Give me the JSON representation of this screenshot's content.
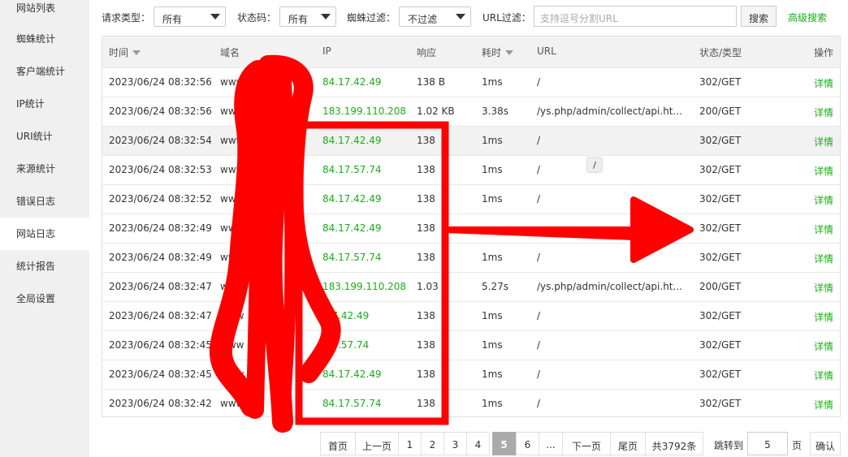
{
  "sidebar": {
    "items": [
      {
        "label": "网站列表"
      },
      {
        "label": "蜘蛛统计"
      },
      {
        "label": "客户端统计"
      },
      {
        "label": "IP统计"
      },
      {
        "label": "URI统计"
      },
      {
        "label": "来源统计"
      },
      {
        "label": "错误日志"
      },
      {
        "label": "网站日志"
      },
      {
        "label": "统计报告"
      },
      {
        "label": "全局设置"
      }
    ]
  },
  "filters": {
    "method_label": "请求类型：",
    "method_value": "所有",
    "status_label": "状态码：",
    "status_value": "所有",
    "spider_label": "蜘蛛过滤：",
    "spider_value": "不过滤",
    "url_label": "URL过滤：",
    "url_placeholder": "支持逗号分割URL",
    "search_label": "搜索",
    "advanced_label": "高级搜索"
  },
  "table": {
    "headers": {
      "time": "时间",
      "domain": "域名",
      "ip": "IP",
      "response": "响应",
      "duration": "耗时",
      "url": "URL",
      "status": "状态/类型",
      "action": "操作"
    },
    "rows": [
      {
        "time": "2023/06/24 08:32:56",
        "domain": "www",
        "ip": "84.17.42.49",
        "response": "138 B",
        "duration": "1ms",
        "url": "/",
        "status": "302/GET",
        "action": "详情"
      },
      {
        "time": "2023/06/24 08:32:56",
        "domain": "www",
        "ip": "183.199.110.208",
        "response": "1.02 KB",
        "duration": "3.38s",
        "url": "/ys.php/admin/collect/api.ht...",
        "status": "200/GET",
        "action": "详情"
      },
      {
        "time": "2023/06/24 08:32:54",
        "domain": "www",
        "ip": "84.17.42.49",
        "response": "138",
        "duration": "1ms",
        "url": "/",
        "status": "302/GET",
        "action": "详情"
      },
      {
        "time": "2023/06/24 08:32:53",
        "domain": "www",
        "ip": "84.17.57.74",
        "response": "138",
        "duration": "1ms",
        "url": "/",
        "status": "302/GET",
        "action": "详情"
      },
      {
        "time": "2023/06/24 08:32:52",
        "domain": "www.",
        "ip": "84.17.42.49",
        "response": "138",
        "duration": "1ms",
        "url": "/",
        "status": "302/GET",
        "action": "详情"
      },
      {
        "time": "2023/06/24 08:32:49",
        "domain": "www.",
        "ip": "84.17.42.49",
        "response": "138",
        "duration": "",
        "url": "",
        "status": "302/GET",
        "action": "详情"
      },
      {
        "time": "2023/06/24 08:32:49",
        "domain": "www.",
        "ip": "84.17.57.74",
        "response": "138",
        "duration": "1ms",
        "url": "/",
        "status": "302/GET",
        "action": "详情"
      },
      {
        "time": "2023/06/24 08:32:47",
        "domain": "www.",
        "ip": "183.199.110.208",
        "response": "1.03 B",
        "duration": "5.27s",
        "url": "/ys.php/admin/collect/api.ht...",
        "status": "200/GET",
        "action": "详情"
      },
      {
        "time": "2023/06/24 08:32:47",
        "domain": "www",
        "ip": ".17.42.49",
        "response": "138",
        "duration": "1ms",
        "url": "/",
        "status": "302/GET",
        "action": "详情"
      },
      {
        "time": "2023/06/24 08:32:45",
        "domain": "www",
        "ip": ".17.57.74",
        "response": "138",
        "duration": "1ms",
        "url": "/",
        "status": "302/GET",
        "action": "详情"
      },
      {
        "time": "2023/06/24 08:32:45",
        "domain": "www.",
        "ip": "84.17.42.49",
        "response": "138",
        "duration": "1ms",
        "url": "/",
        "status": "302/GET",
        "action": "详情"
      },
      {
        "time": "2023/06/24 08:32:42",
        "domain": "www",
        "ip": "84.17.57.74",
        "response": "138",
        "duration": "1ms",
        "url": "/",
        "status": "302/GET",
        "action": "详情"
      }
    ]
  },
  "tooltip": "/",
  "pagination": {
    "first": "首页",
    "prev": "上一页",
    "pages": [
      "1",
      "2",
      "3",
      "4",
      "5",
      "6",
      "..."
    ],
    "active_page": "5",
    "next": "下一页",
    "last": "尾页",
    "total": "共3792条",
    "jump_label": "跳转到",
    "jump_value": "5",
    "page_unit": "页",
    "confirm": "确认"
  },
  "colors": {
    "accent_green": "#1aad19",
    "annotation_red": "#ff0000",
    "sidebar_bg": "#f0f0f0"
  }
}
